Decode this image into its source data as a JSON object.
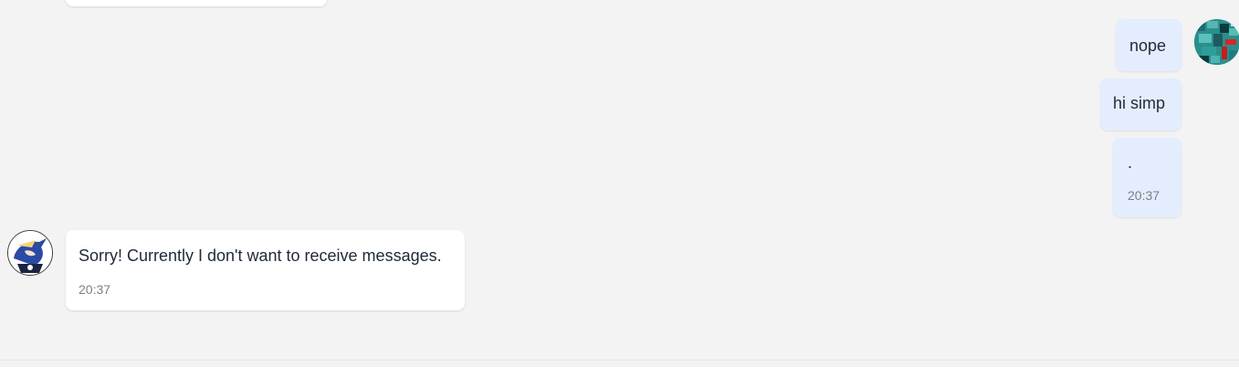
{
  "conversation": {
    "messages": [
      {
        "direction": "outgoing",
        "text": "nope"
      },
      {
        "direction": "outgoing",
        "text": "hi simp"
      },
      {
        "direction": "outgoing",
        "text": ".",
        "time": "20:37"
      },
      {
        "direction": "incoming",
        "text": "Sorry! Currently I don't want to receive messages.",
        "time": "20:37"
      }
    ]
  },
  "avatars": {
    "current_user": {
      "icon": "user-avatar-icon",
      "colors": [
        "#2c9f9a",
        "#1e6b74",
        "#d42828",
        "#0b3b3f",
        "#55b7b2"
      ]
    },
    "other_user": {
      "icon": "anime-character-avatar-icon",
      "colors": [
        "#2b4aa6",
        "#f1d37a",
        "#1c2440",
        "#ffffff"
      ]
    }
  },
  "colors": {
    "background": "#f3f3f3",
    "outgoing_bubble": "#e3edfd",
    "incoming_bubble": "#ffffff",
    "timestamp": "#7a7f87"
  }
}
